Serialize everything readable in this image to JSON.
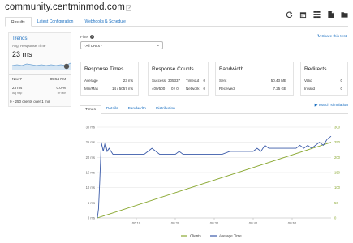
{
  "header": {
    "site_title": "community.centminmod.com",
    "icons": [
      "refresh-icon",
      "calendar-icon",
      "grid-icon",
      "document-icon",
      "folder-icon"
    ]
  },
  "tabs": [
    {
      "label": "Results",
      "active": true
    },
    {
      "label": "Latest Configuration",
      "active": false
    },
    {
      "label": "Webhooks & Schedule",
      "active": false
    }
  ],
  "trends": {
    "title": "Trends",
    "subtitle": "Avg. Response Time",
    "value": "23 ms",
    "badge": "",
    "date": "Nov 7",
    "time": "05:54 PM",
    "resp": "23 ms",
    "resp_label": "avg resp",
    "err": "0.0 %",
    "err_label": "err rate",
    "footer": "0 - 250 clients over 1 min"
  },
  "filter": {
    "label": "Filter",
    "selected": "- All URLs -"
  },
  "share_label": "Share this test",
  "cards": {
    "response_times": {
      "title": "Response Times",
      "average_label": "Average",
      "average": "23 ms",
      "minmax_label": "Min/Max",
      "minmax": "14 / 5057 ms"
    },
    "response_counts": {
      "title": "Response Counts",
      "success_label": "Success",
      "success": "305337",
      "timeout_label": "Timeout",
      "timeout": "0",
      "e400_label": "400/500",
      "e400": "0 / 0",
      "network_label": "Network",
      "network": "0"
    },
    "bandwidth": {
      "title": "Bandwidth",
      "sent_label": "Sent",
      "sent": "50.43 MB",
      "received_label": "Received",
      "received": "7.25 GB"
    },
    "redirects": {
      "title": "Redirects",
      "valid_label": "Valid",
      "valid": "0",
      "invalid_label": "Invalid",
      "invalid": "0"
    }
  },
  "chart_tabs": [
    {
      "label": "Times",
      "active": true
    },
    {
      "label": "Details",
      "active": false
    },
    {
      "label": "Bandwidth",
      "active": false
    },
    {
      "label": "Distribution",
      "active": false
    }
  ],
  "watch_label": "Watch simulation",
  "chart_data": {
    "type": "line",
    "x_ticks": [
      "00:10",
      "00:20",
      "00:30",
      "00:40",
      "00:50"
    ],
    "x_range": [
      0,
      60
    ],
    "left_axis": {
      "ticks": [
        "0 ms",
        "5 ms",
        "10 ms",
        "15 ms",
        "20 ms",
        "25 ms",
        "30 ms"
      ],
      "range": [
        0,
        30
      ]
    },
    "right_axis": {
      "ticks": [
        "0",
        "50",
        "100",
        "150",
        "200",
        "250",
        "300"
      ],
      "range": [
        0,
        300
      ]
    },
    "series": [
      {
        "name": "Clients",
        "axis": "right",
        "color": "#8aa832",
        "x": [
          0,
          60
        ],
        "values": [
          0,
          250
        ]
      },
      {
        "name": "Average Time",
        "axis": "left",
        "color": "#3b5ba9",
        "x": [
          0,
          0.3,
          0.6,
          1,
          1.5,
          2,
          2.5,
          3,
          3.5,
          4,
          5,
          6,
          8,
          10,
          12,
          13,
          14,
          15,
          16,
          18,
          20,
          21,
          22,
          24,
          26,
          28,
          30,
          32,
          34,
          36,
          38,
          40,
          41,
          42,
          43,
          44,
          45,
          46,
          47,
          48,
          50,
          51,
          52,
          53,
          54,
          55,
          56,
          57,
          58,
          59,
          60
        ],
        "values": [
          0,
          3,
          12,
          25,
          22,
          25,
          22,
          23,
          22,
          21,
          21,
          21,
          21,
          21,
          21,
          22,
          23,
          22,
          21,
          21,
          21,
          22,
          21,
          21,
          21,
          21,
          21,
          21,
          22,
          22,
          22,
          22,
          23,
          22,
          24,
          23,
          23,
          23,
          23,
          23,
          23,
          23,
          24,
          23,
          24,
          23,
          24,
          25,
          24,
          26,
          27
        ]
      }
    ]
  }
}
